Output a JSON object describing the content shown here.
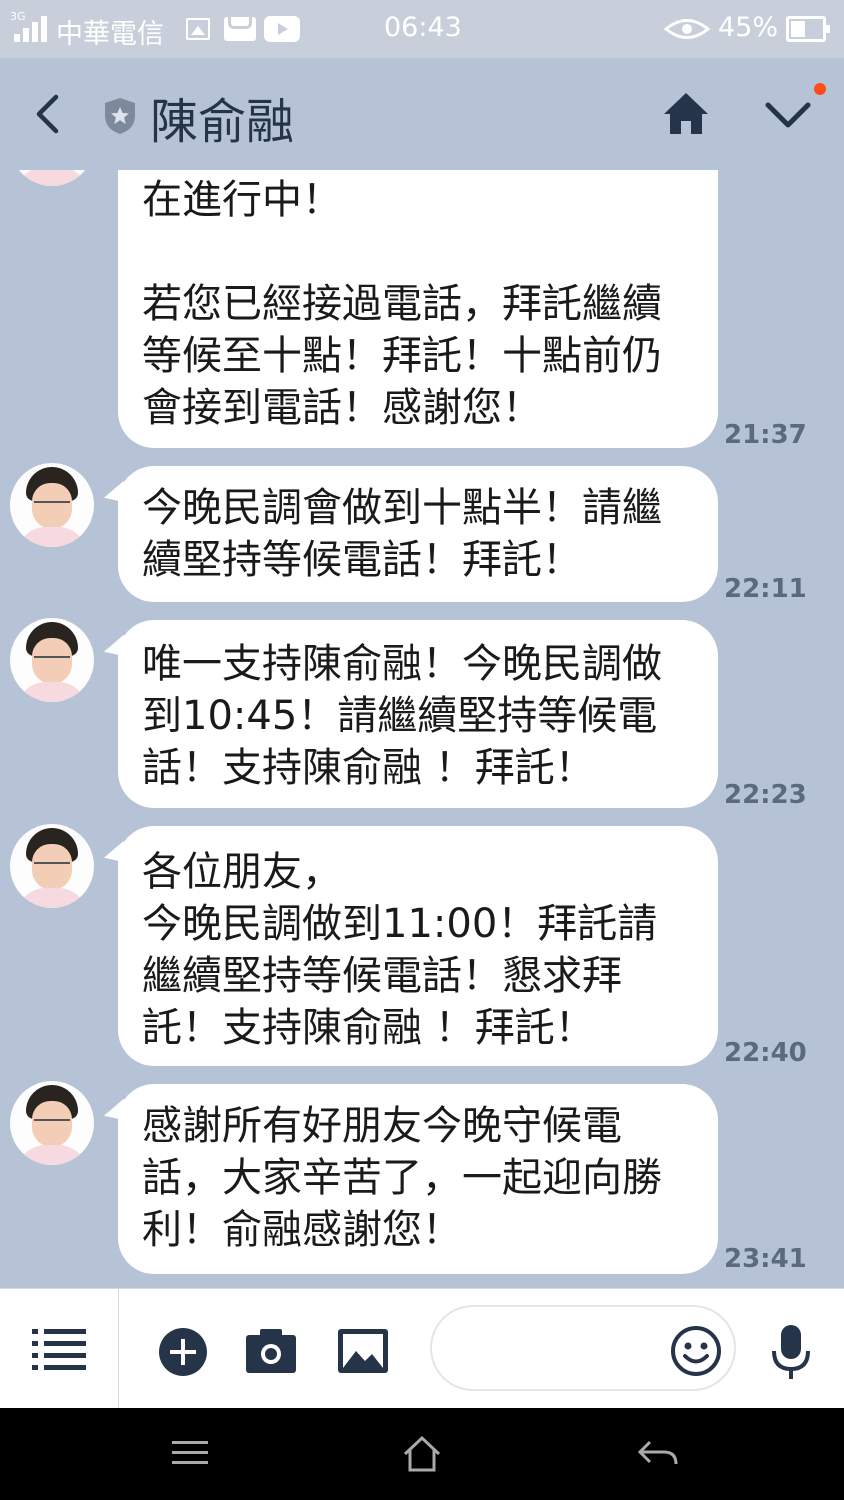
{
  "status_bar": {
    "network": "3G",
    "carrier": "中華電信",
    "time": "06:43",
    "battery": "45%"
  },
  "header": {
    "title": "陳俞融",
    "back_icon": "back-arrow-icon",
    "shield_icon": "official-account-shield-icon",
    "home_icon": "home-icon",
    "menu_icon": "chevron-down-icon"
  },
  "messages": [
    {
      "text": "在進行中！\n\n若您已經接過電話，拜託繼續等候至十點！拜託！十點前仍會接到電話！感謝您！",
      "time": "21:37"
    },
    {
      "text": "今晚民調會做到十點半！請繼續堅持等候電話！拜託！",
      "time": "22:11"
    },
    {
      "text": "唯一支持陳俞融！今晚民調做到10:45！請繼續堅持等候電話！支持陳俞融 ！拜託！",
      "time": "22:23"
    },
    {
      "text": "各位朋友，\n今晚民調做到11:00！拜託請繼續堅持等候電話！懇求拜託！支持陳俞融 ！拜託！",
      "time": "22:40"
    },
    {
      "text": "感謝所有好朋友今晚守候電話，大家辛苦了，一起迎向勝利！俞融感謝您！",
      "time": "23:41"
    }
  ],
  "input": {
    "placeholder": ""
  },
  "colors": {
    "background": "#b6c2d6",
    "bubble": "#ffffff",
    "accent_icon": "#26344a",
    "notification_dot": "#ff4a1a"
  }
}
